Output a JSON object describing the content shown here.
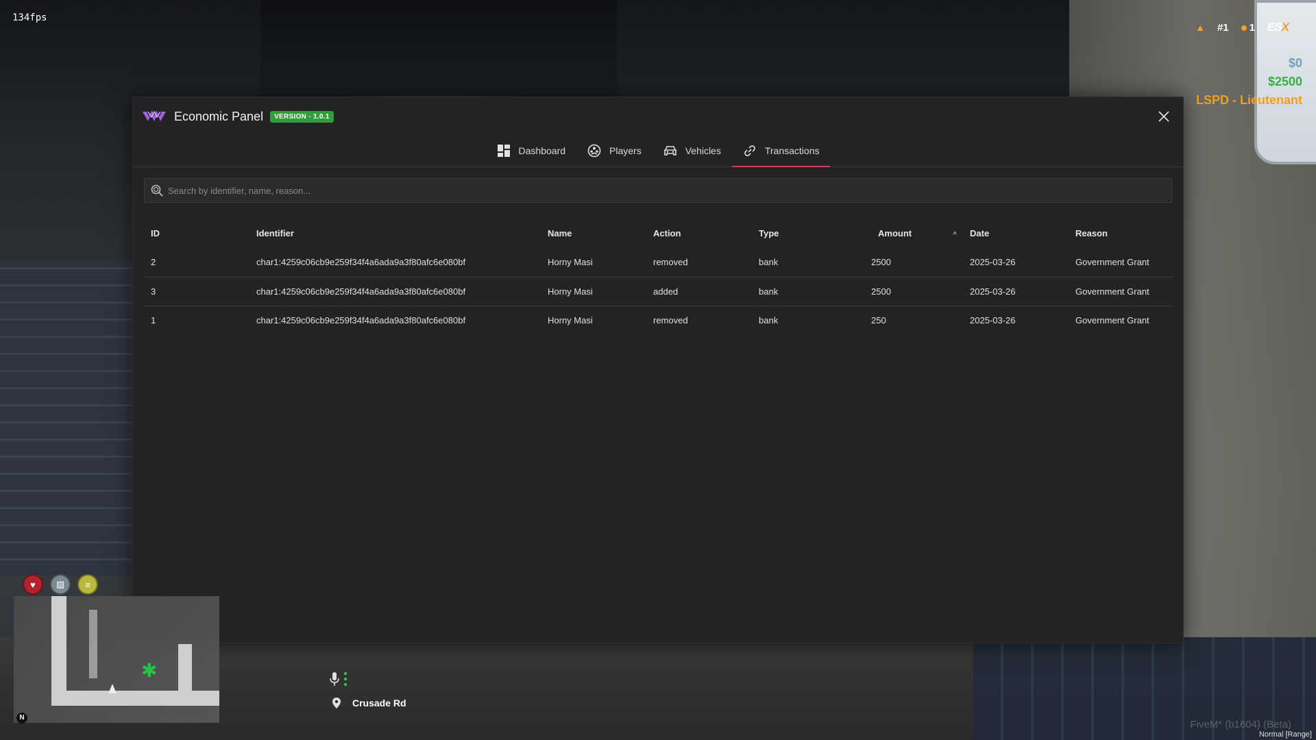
{
  "hud": {
    "fps": "134fps",
    "rank": "#1",
    "count": "1",
    "framework": "ES",
    "framework_x": "X",
    "cash": "$0",
    "bank": "$2500",
    "job": "LSPD - Lieutenant",
    "street": "Crusade Rd",
    "compass": "N",
    "footer": "FiveM* (b1604) (Beta)",
    "voice_mode": "Normal [Range]"
  },
  "panel": {
    "title": "Economic Panel",
    "version": "VERSION - 1.0.1",
    "tabs": [
      {
        "label": "Dashboard",
        "icon": "dashboard-icon"
      },
      {
        "label": "Players",
        "icon": "players-icon"
      },
      {
        "label": "Vehicles",
        "icon": "car-icon"
      },
      {
        "label": "Transactions",
        "icon": "link-icon"
      }
    ],
    "active_tab": "Transactions",
    "accent_color": "#d33d5a",
    "search": {
      "placeholder": "Search by identifier, name, reason..."
    },
    "table": {
      "headers": [
        "ID",
        "Identifier",
        "Name",
        "Action",
        "Type",
        "Amount",
        "Date",
        "Reason"
      ],
      "sort_indicator": "^",
      "rows": [
        {
          "id": "2",
          "identifier": "char1:4259c06cb9e259f34f4a6ada9a3f80afc6e080bf",
          "name": "Horny Masi",
          "action": "removed",
          "type": "bank",
          "amount": "2500",
          "date": "2025-03-26",
          "reason": "Government Grant"
        },
        {
          "id": "3",
          "identifier": "char1:4259c06cb9e259f34f4a6ada9a3f80afc6e080bf",
          "name": "Horny Masi",
          "action": "added",
          "type": "bank",
          "amount": "2500",
          "date": "2025-03-26",
          "reason": "Government Grant"
        },
        {
          "id": "1",
          "identifier": "char1:4259c06cb9e259f34f4a6ada9a3f80afc6e080bf",
          "name": "Horny Masi",
          "action": "removed",
          "type": "bank",
          "amount": "250",
          "date": "2025-03-26",
          "reason": "Government Grant"
        }
      ]
    }
  }
}
